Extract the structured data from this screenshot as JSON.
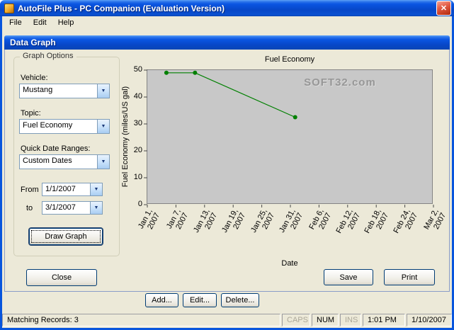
{
  "window": {
    "title": "AutoFile Plus - PC Companion (Evaluation Version)",
    "close_glyph": "✕"
  },
  "menu": {
    "items": [
      {
        "label": "File"
      },
      {
        "label": "Edit"
      },
      {
        "label": "Help"
      }
    ]
  },
  "dialog": {
    "title": "Data Graph",
    "graph_options": {
      "legend": "Graph Options",
      "vehicle_label": "Vehicle:",
      "vehicle_value": "Mustang",
      "topic_label": "Topic:",
      "topic_value": "Fuel Economy",
      "range_label": "Quick Date Ranges:",
      "range_value": "Custom Dates",
      "from_label": "From",
      "from_value": "1/1/2007",
      "to_label": "to",
      "to_value": "3/1/2007",
      "draw_button_label": "Draw Graph",
      "dropdown_glyph": "▼"
    },
    "close_button_label": "Close",
    "save_button_label": "Save",
    "print_button_label": "Print"
  },
  "record_actions": {
    "add_label": "Add...",
    "edit_label": "Edit...",
    "delete_label": "Delete..."
  },
  "status_bar": {
    "message": "Matching Records: 3",
    "caps": "CAPS",
    "num": "NUM",
    "ins": "INS",
    "time": "1:01 PM",
    "date": "1/10/2007"
  },
  "watermark": "SOFT32.com",
  "chart_data": {
    "type": "line",
    "title": "Fuel Economy",
    "xlabel": "Date",
    "ylabel": "Fuel Economy (miles/US gal)",
    "x_tick_labels": [
      "Jan 1, 2007",
      "Jan 7, 2007",
      "Jan 13, 2007",
      "Jan 19, 2007",
      "Jan 25, 2007",
      "Jan 31, 2007",
      "Feb 6, 2007",
      "Feb 12, 2007",
      "Feb 18, 2007",
      "Feb 24, 2007",
      "Mar 2, 2007"
    ],
    "x_tick_days": [
      0,
      6,
      12,
      18,
      24,
      30,
      36,
      42,
      48,
      54,
      60
    ],
    "xlim_days": [
      0,
      60
    ],
    "y_ticks": [
      0,
      10,
      20,
      30,
      40,
      50
    ],
    "ylim": [
      0,
      50
    ],
    "grid": false,
    "legend_position": "none",
    "plot_background": "#C8C8C8",
    "series": [
      {
        "name": "Fuel Economy",
        "color": "#008000",
        "points": [
          {
            "date": "Jan 5, 2007",
            "day": 4,
            "value": 49
          },
          {
            "date": "Jan 11, 2007",
            "day": 10,
            "value": 49
          },
          {
            "date": "Jan 31, 2007",
            "day": 31,
            "value": 32.5
          }
        ]
      }
    ]
  }
}
